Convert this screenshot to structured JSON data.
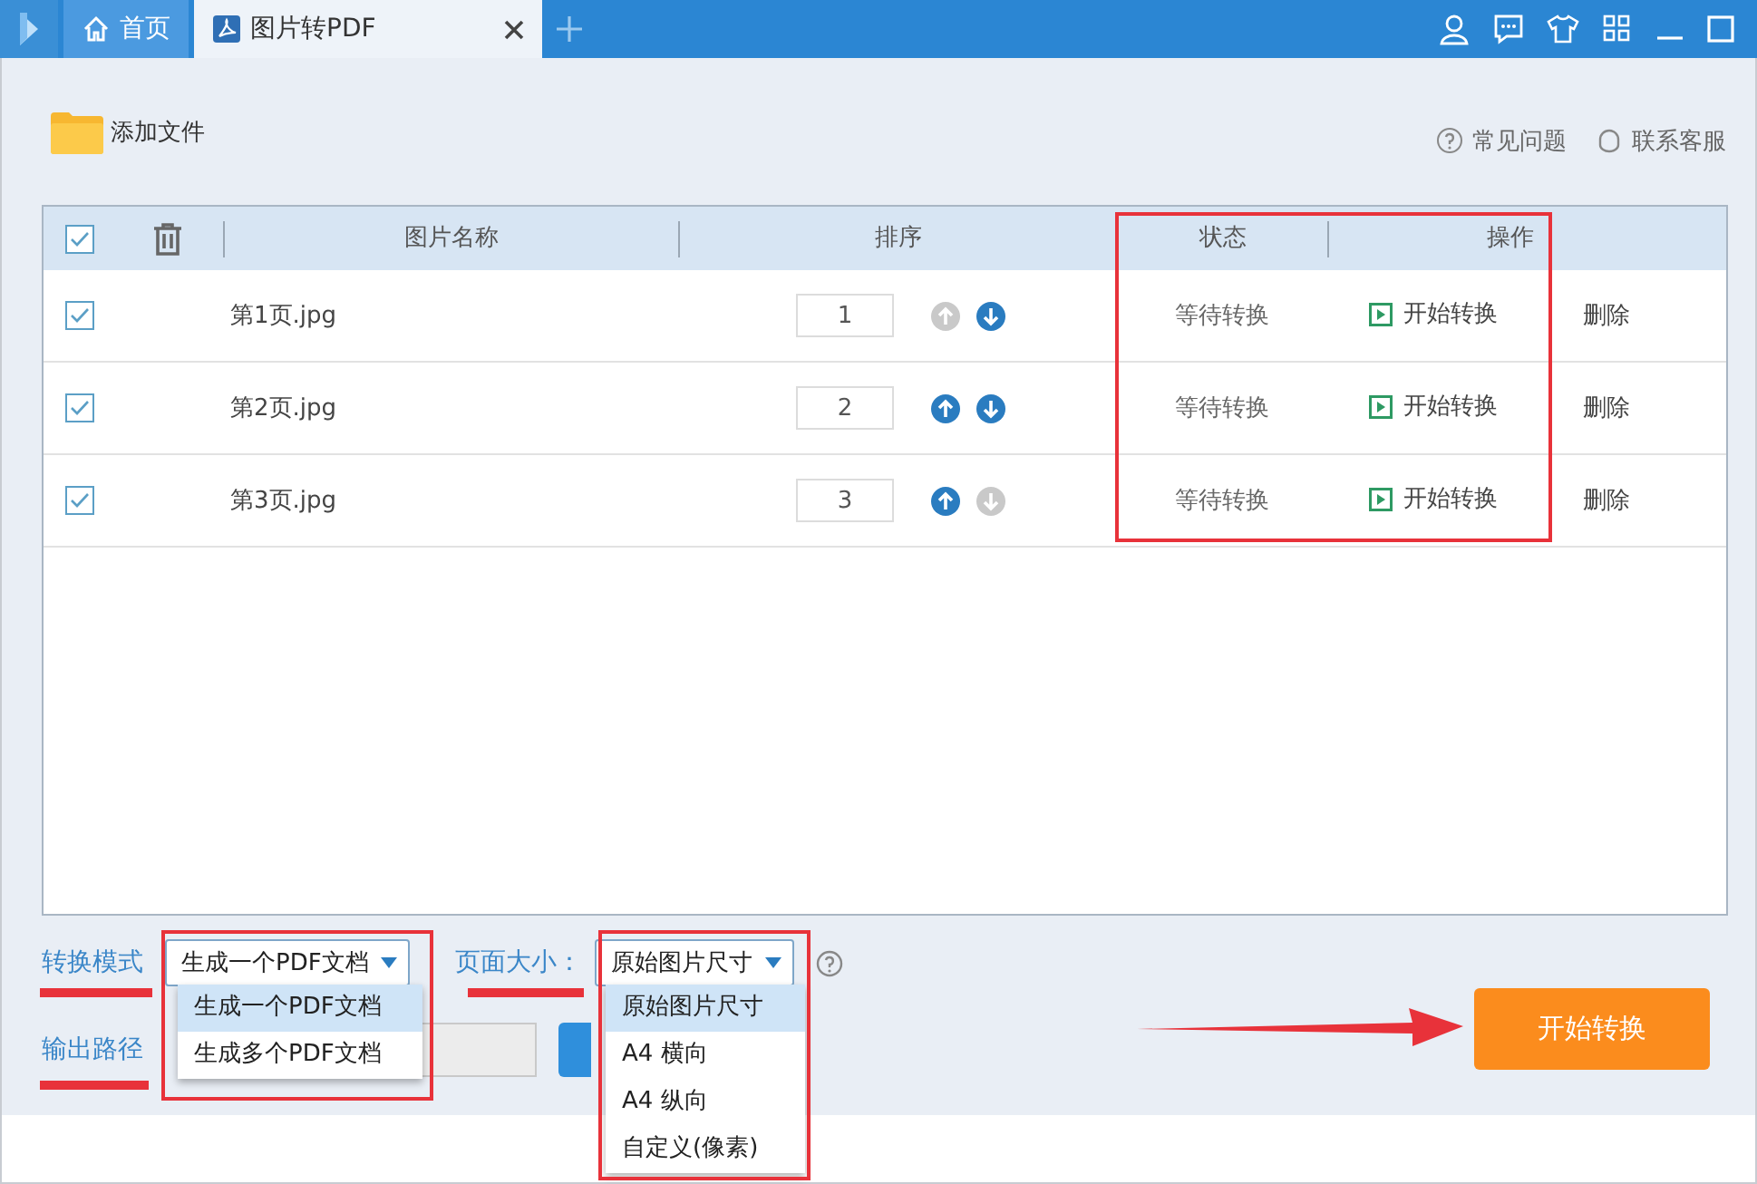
{
  "tabs": [
    {
      "label": "首页",
      "kind": "home",
      "selected": false
    },
    {
      "label": "图片转PDF",
      "kind": "pdf",
      "selected": true
    }
  ],
  "toolbar": {
    "add_file": "添加文件",
    "links": [
      {
        "label": "常见问题",
        "kind": "help"
      },
      {
        "label": "联系客服",
        "kind": "service"
      }
    ]
  },
  "table": {
    "all_checked": true,
    "columns": [
      "图片名称",
      "排序",
      "状态",
      "操作"
    ],
    "rows": [
      {
        "checked": true,
        "name": "第1页.jpg",
        "order": "1",
        "up_enabled": false,
        "down_enabled": true,
        "status": "等待转换",
        "action": "开始转换",
        "delete": "删除"
      },
      {
        "checked": true,
        "name": "第2页.jpg",
        "order": "2",
        "up_enabled": true,
        "down_enabled": true,
        "status": "等待转换",
        "action": "开始转换",
        "delete": "删除"
      },
      {
        "checked": true,
        "name": "第3页.jpg",
        "order": "3",
        "up_enabled": true,
        "down_enabled": false,
        "status": "等待转换",
        "action": "开始转换",
        "delete": "删除"
      }
    ]
  },
  "mode": {
    "label": "转换模式",
    "value": "生成一个PDF文档",
    "options": [
      {
        "label": "生成一个PDF文档",
        "selected": true
      },
      {
        "label": "生成多个PDF文档",
        "selected": false
      }
    ]
  },
  "page_size": {
    "label": "页面大小：",
    "value": "原始图片尺寸",
    "options": [
      {
        "label": "原始图片尺寸",
        "selected": true
      },
      {
        "label": "A4 横向",
        "selected": false
      },
      {
        "label": "A4 纵向",
        "selected": false
      },
      {
        "label": "自定义(像素)",
        "selected": false
      }
    ]
  },
  "output": {
    "label": "输出路径"
  },
  "start_button": "开始转换"
}
